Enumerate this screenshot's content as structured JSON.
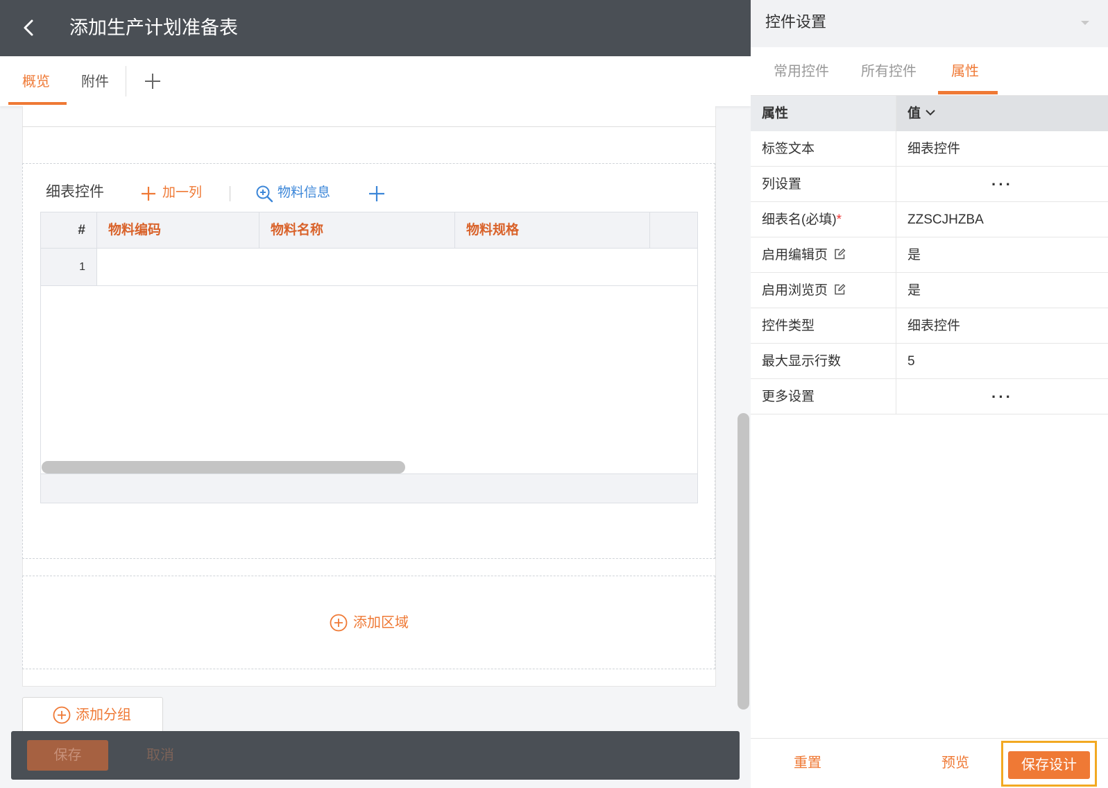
{
  "header": {
    "title": "添加生产计划准备表"
  },
  "tabs": [
    {
      "label": "概览"
    },
    {
      "label": "附件"
    }
  ],
  "detail": {
    "label": "细表控件",
    "add_column": "加一列",
    "material_info": "物料信息",
    "columns": [
      "#",
      "物料编码",
      "物料名称",
      "物料规格"
    ],
    "rows": [
      {
        "num": "1"
      }
    ]
  },
  "add_area": "添加区域",
  "add_group": "添加分组",
  "footer": {
    "save": "保存",
    "cancel": "取消"
  },
  "panel": {
    "title": "控件设置",
    "tabs": [
      "常用控件",
      "所有控件",
      "属性"
    ],
    "table_head": {
      "key": "属性",
      "value": "值"
    },
    "props": [
      {
        "key": "标签文本",
        "value": "细表控件"
      },
      {
        "key": "列设置",
        "value": "···"
      },
      {
        "key": "细表名(必填)",
        "required": "*",
        "value": "ZZSCJHZBA"
      },
      {
        "key": "启用编辑页",
        "value": "是"
      },
      {
        "key": "启用浏览页",
        "value": "是"
      },
      {
        "key": "控件类型",
        "value": "细表控件"
      },
      {
        "key": "最大显示行数",
        "value": "5"
      },
      {
        "key": "更多设置",
        "value": "···"
      }
    ],
    "footer": {
      "reset": "重置",
      "preview": "预览",
      "save_design": "保存设计"
    }
  },
  "colors": {
    "accent": "#ef7935",
    "topbar": "#4a4f55",
    "link_blue": "#3b86d8",
    "highlight_border": "#f2a922"
  }
}
